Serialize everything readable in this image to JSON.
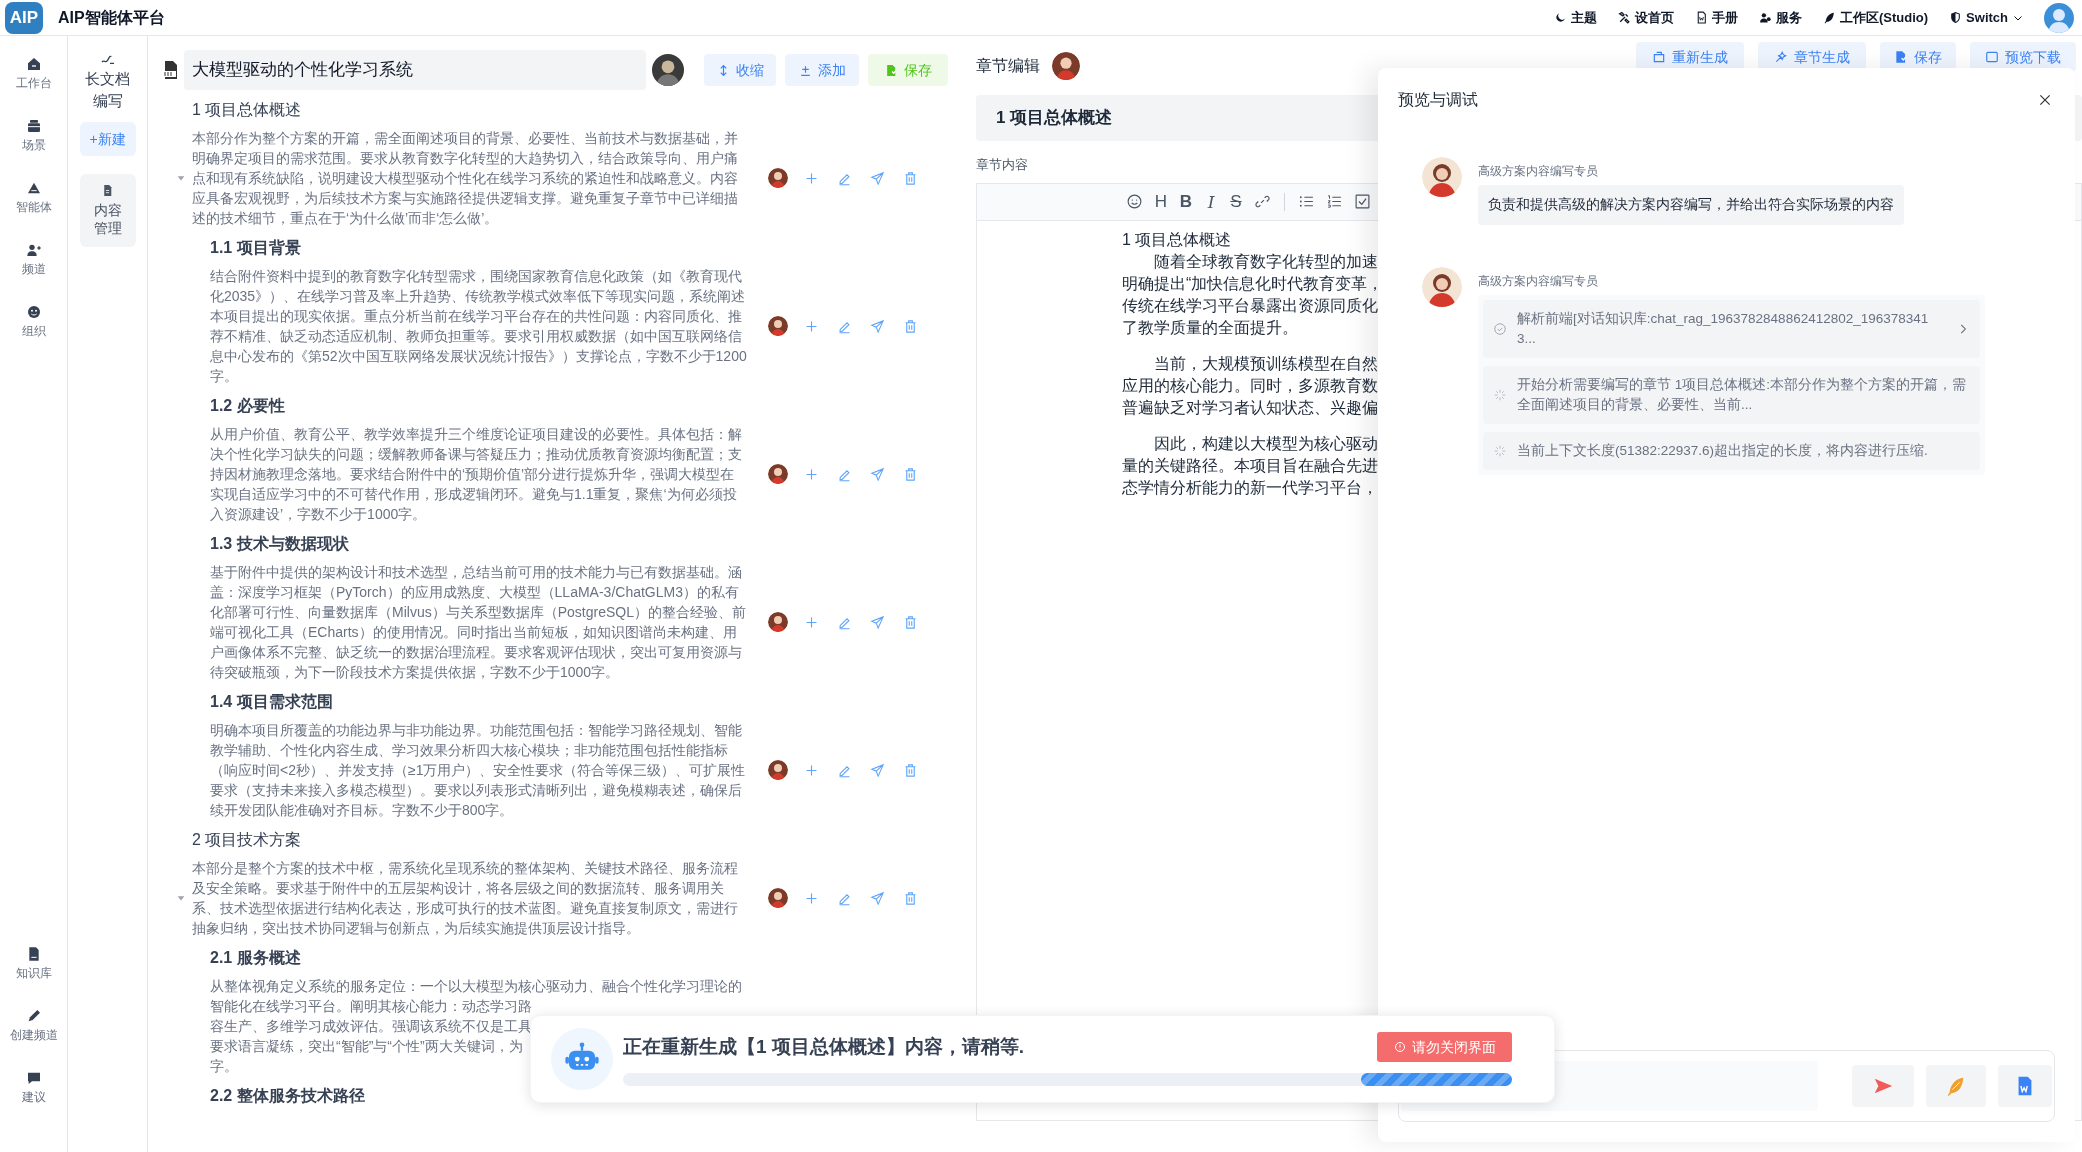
{
  "app": {
    "logo": "AIP",
    "name": "AIP智能体平台"
  },
  "top_menu": [
    {
      "kind": "theme",
      "label": "主题"
    },
    {
      "kind": "home",
      "label": "设首页"
    },
    {
      "kind": "manual",
      "label": "手册"
    },
    {
      "kind": "service",
      "label": "服务"
    },
    {
      "kind": "studio",
      "label": "工作区(Studio)"
    },
    {
      "kind": "switch",
      "label": "Switch"
    }
  ],
  "nav": [
    {
      "kind": "workbench",
      "label": "工作台"
    },
    {
      "kind": "scene",
      "label": "场景"
    },
    {
      "kind": "agent",
      "label": "智能体"
    },
    {
      "kind": "channel",
      "label": "频道"
    },
    {
      "kind": "org",
      "label": "组织"
    }
  ],
  "nav_bottom": [
    {
      "kind": "knowledge",
      "label": "知识库"
    },
    {
      "kind": "create",
      "label": "创建频道"
    },
    {
      "kind": "suggest",
      "label": "建议"
    }
  ],
  "subnav": {
    "title": "长文档编写",
    "new_button": "+新建",
    "items": [
      {
        "label": "内容管理",
        "selected": true
      }
    ]
  },
  "outline": {
    "title": "大模型驱动的个性化学习系统",
    "buttons": [
      {
        "kind": "collapse",
        "label": "收缩"
      },
      {
        "kind": "add",
        "label": "添加"
      },
      {
        "kind": "save",
        "label": "保存"
      }
    ],
    "sections": [
      {
        "heading": "1 项目总体概述",
        "expanded": true,
        "body": "本部分作为整个方案的开篇，需全面阐述项目的背景、必要性、当前技术与数据基础，并明确界定项目的需求范围。要求从教育数字化转型的大趋势切入，结合政策导向、用户痛点和现有系统缺陷，说明建设大模型驱动个性化在线学习系统的紧迫性和战略意义。内容应具备宏观视野，为后续技术方案与实施路径提供逻辑支撑。避免重复子章节中已详细描述的技术细节，重点在于‘为什么做’而非‘怎么做’。",
        "children": [
          {
            "heading": "1.1 项目背景",
            "body": "结合附件资料中提到的教育数字化转型需求，围绕国家教育信息化政策（如《教育现代化2035》）、在线学习普及率上升趋势、传统教学模式效率低下等现实问题，系统阐述本项目提出的现实依据。重点分析当前在线学习平台存在的共性问题：内容同质化、推荐不精准、缺乏动态适应机制、教师负担重等。要求引用权威数据（如中国互联网络信息中心发布的《第52次中国互联网络发展状况统计报告》）支撑论点，字数不少于1200字。"
          },
          {
            "heading": "1.2 必要性",
            "body": "从用户价值、教育公平、教学效率提升三个维度论证项目建设的必要性。具体包括：解决个性化学习缺失的问题；缓解教师备课与答疑压力；推动优质教育资源均衡配置；支持因材施教理念落地。要求结合附件中的‘预期价值’部分进行提炼升华，强调大模型在实现自适应学习中的不可替代作用，形成逻辑闭环。避免与1.1重复，聚焦‘为何必须投入资源建设’，字数不少于1000字。"
          },
          {
            "heading": "1.3 技术与数据现状",
            "body": "基于附件中提供的架构设计和技术选型，总结当前可用的技术能力与已有数据基础。涵盖：深度学习框架（PyTorch）的应用成熟度、大模型（LLaMA-3/ChatGLM3）的私有化部署可行性、向量数据库（Milvus）与关系型数据库（PostgreSQL）的整合经验、前端可视化工具（ECharts）的使用情况。同时指出当前短板，如知识图谱尚未构建、用户画像体系不完整、缺乏统一的数据治理流程。要求客观评估现状，突出可复用资源与待突破瓶颈，为下一阶段技术方案提供依据，字数不少于1000字。"
          },
          {
            "heading": "1.4 项目需求范围",
            "body": "明确本项目所覆盖的功能边界与非功能边界。功能范围包括：智能学习路径规划、智能教学辅助、个性化内容生成、学习效果分析四大核心模块；非功能范围包括性能指标（响应时间<2秒）、并发支持（≥1万用户）、安全性要求（符合等保三级）、可扩展性要求（支持未来接入多模态模型）。要求以列表形式清晰列出，避免模糊表述，确保后续开发团队能准确对齐目标。字数不少于800字。"
          }
        ]
      },
      {
        "heading": "2 项目技术方案",
        "expanded": true,
        "body": "本部分是整个方案的技术中枢，需系统化呈现系统的整体架构、关键技术路径、服务流程及安全策略。要求基于附件中的五层架构设计，将各层级之间的数据流转、服务调用关系、技术选型依据进行结构化表达，形成可执行的技术蓝图。避免直接复制原文，需进行抽象归纳，突出技术协同逻辑与创新点，为后续实施提供顶层设计指导。",
        "children": [
          {
            "heading": "2.1 服务概述",
            "body_lines": [
              "从整体视角定义系统的服务定位：一个以大模型为核心驱动力、融合个性化学习理论的",
              "智能化在线学习平台。阐明其核心能力：动态学习路",
              "容生产、多维学习成效评估。强调该系统不仅是工具",
              "要求语言凝练，突出“智能”与“个性”两大关键词，为",
              "字。"
            ]
          },
          {
            "heading": "2.2 整体服务技术路径"
          }
        ]
      }
    ]
  },
  "editor": {
    "title": "章节编辑",
    "actions": [
      {
        "kind": "regen",
        "label": "重新生成"
      },
      {
        "kind": "generate",
        "label": "章节生成"
      },
      {
        "kind": "save",
        "label": "保存"
      },
      {
        "kind": "preview",
        "label": "预览下载"
      }
    ],
    "heading": "1 项目总体概述",
    "content_label": "章节内容",
    "toolbar": [
      {
        "kind": "emoji"
      },
      {
        "kind": "letter",
        "label": "H"
      },
      {
        "kind": "bold",
        "label": "B"
      },
      {
        "kind": "italic",
        "label": "I"
      },
      {
        "kind": "strike",
        "label": "S"
      },
      {
        "kind": "link"
      },
      {
        "kind": "divider"
      },
      {
        "kind": "bullets"
      },
      {
        "kind": "numbers"
      },
      {
        "kind": "task"
      }
    ],
    "content": [
      {
        "kind": "title",
        "text": "1 项目总体概述"
      },
      {
        "kind": "paragraph",
        "lines": [
          "随着全球教育数字化转型的加速",
          "明确提出“加快信息化时代教育变革，",
          "传统在线学习平台暴露出资源同质化",
          "了教学质量的全面提升。"
        ]
      },
      {
        "kind": "paragraph",
        "lines": [
          "当前，大规模预训练模型在自然",
          "应用的核心能力。同时，多源教育数",
          "普遍缺乏对学习者认知状态、兴趣偏"
        ]
      },
      {
        "kind": "paragraph",
        "lines": [
          "因此，构建以大模型为核心驱动",
          "量的关键路径。本项目旨在融合先进",
          "态学情分析能力的新一代学习平台，"
        ]
      }
    ]
  },
  "preview": {
    "title": "预览与调试",
    "messages": [
      {
        "kind": "text",
        "author": "高级方案内容编写专员",
        "text": "负责和提供高级的解决方案内容编写，并给出符合实际场景的内容"
      },
      {
        "kind": "steps",
        "author": "高级方案内容编写专员",
        "steps": [
          {
            "done": true,
            "expandable": true,
            "text": "解析前端[对话知识库:chat_rag_1963782848862412802_1963783413..."
          },
          {
            "done": false,
            "expandable": false,
            "text": "开始分析需要编写的章节 1项目总体概述:本部分作为整个方案的开篇，需全面阐述项目的背景、必要性、当前..."
          },
          {
            "done": false,
            "expandable": false,
            "text": "当前上下文长度(51382:22937.6)超出指定的长度，将内容进行压缩."
          }
        ]
      }
    ],
    "input_buttons": [
      {
        "kind": "send"
      },
      {
        "kind": "feather"
      },
      {
        "kind": "word"
      }
    ]
  },
  "toast": {
    "message": "正在重新生成【1 项目总体概述】内容，请稍等.",
    "warning": "请勿关闭界面"
  }
}
